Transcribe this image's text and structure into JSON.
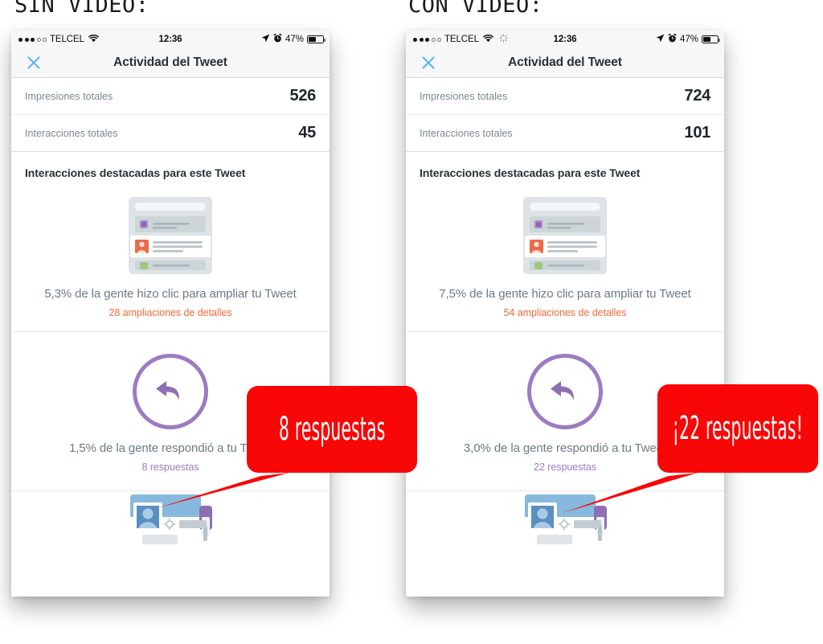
{
  "captions": {
    "left": "SIN VIDEO:",
    "right": "CON VIDEO:"
  },
  "colors": {
    "callout_red": "#f90606",
    "link_orange": "#f0693b",
    "link_purple": "#9b7cc2",
    "nav_blue": "#5ab5ef",
    "label_gray": "#7a8793",
    "value_dark": "#20262c"
  },
  "phones": [
    {
      "id": "sin-video",
      "status_bar": {
        "carrier": "TELCEL",
        "signal_dots_filled": 3,
        "signal_dots_hollow": 2,
        "wifi_icon": "wifi-icon",
        "spinner_icon": null,
        "time": "12:36",
        "location_icon": "location-arrow-icon",
        "alarm_icon": "alarm-clock-icon",
        "battery_percent": "47%",
        "battery_icon": "battery-icon"
      },
      "nav": {
        "close_icon": "close-icon",
        "title": "Actividad del Tweet"
      },
      "stats": [
        {
          "label": "Impresiones totales",
          "value": "526"
        },
        {
          "label": "Interacciones totales",
          "value": "45"
        }
      ],
      "section_title": "Interacciones destacadas para este Tweet",
      "cards": [
        {
          "art": "tweet-expand-illustration",
          "line1": "5,3% de la gente hizo clic para ampliar tu Tweet",
          "line2": "28 ampliaciones de detalles",
          "line2_color": "orange"
        },
        {
          "art": "reply-circle-icon",
          "line1": "1,5% de la gente respondió a tu Tweet",
          "line2": "8 respuestas",
          "line2_color": "purple"
        },
        {
          "art": "profile-card-illustration",
          "line1": "",
          "line2": "",
          "line2_color": "purple"
        }
      ],
      "callout": "8 respuestas"
    },
    {
      "id": "con-video",
      "status_bar": {
        "carrier": "TELCEL",
        "signal_dots_filled": 3,
        "signal_dots_hollow": 2,
        "wifi_icon": "wifi-icon",
        "spinner_icon": "spinner-icon",
        "time": "12:36",
        "location_icon": "location-arrow-icon",
        "alarm_icon": "alarm-clock-icon",
        "battery_percent": "47%",
        "battery_icon": "battery-icon"
      },
      "nav": {
        "close_icon": "close-icon",
        "title": "Actividad del Tweet"
      },
      "stats": [
        {
          "label": "Impresiones totales",
          "value": "724"
        },
        {
          "label": "Interacciones totales",
          "value": "101"
        }
      ],
      "section_title": "Interacciones destacadas para este Tweet",
      "cards": [
        {
          "art": "tweet-expand-illustration",
          "line1": "7,5% de la gente hizo clic para ampliar tu Tweet",
          "line2": "54 ampliaciones de detalles",
          "line2_color": "orange"
        },
        {
          "art": "reply-circle-icon",
          "line1": "3,0% de la gente respondió a tu Tweet",
          "line2": "22 respuestas",
          "line2_color": "purple"
        },
        {
          "art": "profile-card-illustration",
          "line1": "",
          "line2": "",
          "line2_color": "purple"
        }
      ],
      "callout": "¡22 respuestas!"
    }
  ]
}
